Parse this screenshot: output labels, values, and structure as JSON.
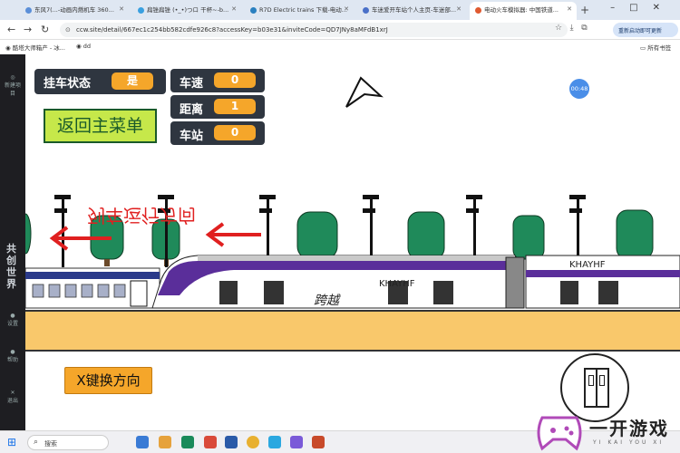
{
  "browser": {
    "tabs": [
      {
        "label": "东风7(...-动画内燃机车 360..."
      },
      {
        "label": "扁锉扁锉 (•_•)つロ 干杯~-b..."
      },
      {
        "label": "R7D Electric trains 下载-电动..."
      },
      {
        "label": "车迷爱开车站个人主页-车迷部..."
      },
      {
        "label": "电动火车模拟器: 中国铁道..."
      }
    ],
    "url": "ccw.site/detail/667ec1c254bb582cdfe926c8?accessKey=b03e31&inviteCode=QD7JNy8aMFdB1xrJ",
    "profile_label": "重新启动即可更新",
    "bookmarks": [
      "酷塔大师箱产 - 冰...",
      "dd"
    ],
    "bookmarks_folder": "所有书签"
  },
  "sidebar": {
    "items": [
      "新建项目",
      "共创世界",
      "设置",
      "帮助",
      "退出"
    ],
    "world_label": "共创世界"
  },
  "game": {
    "hitch_status_label": "挂车状态",
    "hitch_status_value": "是",
    "speed_label": "车速",
    "speed_value": "0",
    "distance_label": "距离",
    "distance_value": "1",
    "station_label": "车站",
    "station_value": "0",
    "back_button": "返回主菜单",
    "switch_direction_button": "X键换方向",
    "timer": "00:48",
    "train_direction_text": "列车运行方向",
    "train_name": "跨越",
    "car_lettering": "KHAYHF"
  },
  "taskbar": {
    "search_placeholder": "搜索"
  },
  "watermark": {
    "title": "一开游戏",
    "subtitle": "YI KAI YOU XI"
  }
}
